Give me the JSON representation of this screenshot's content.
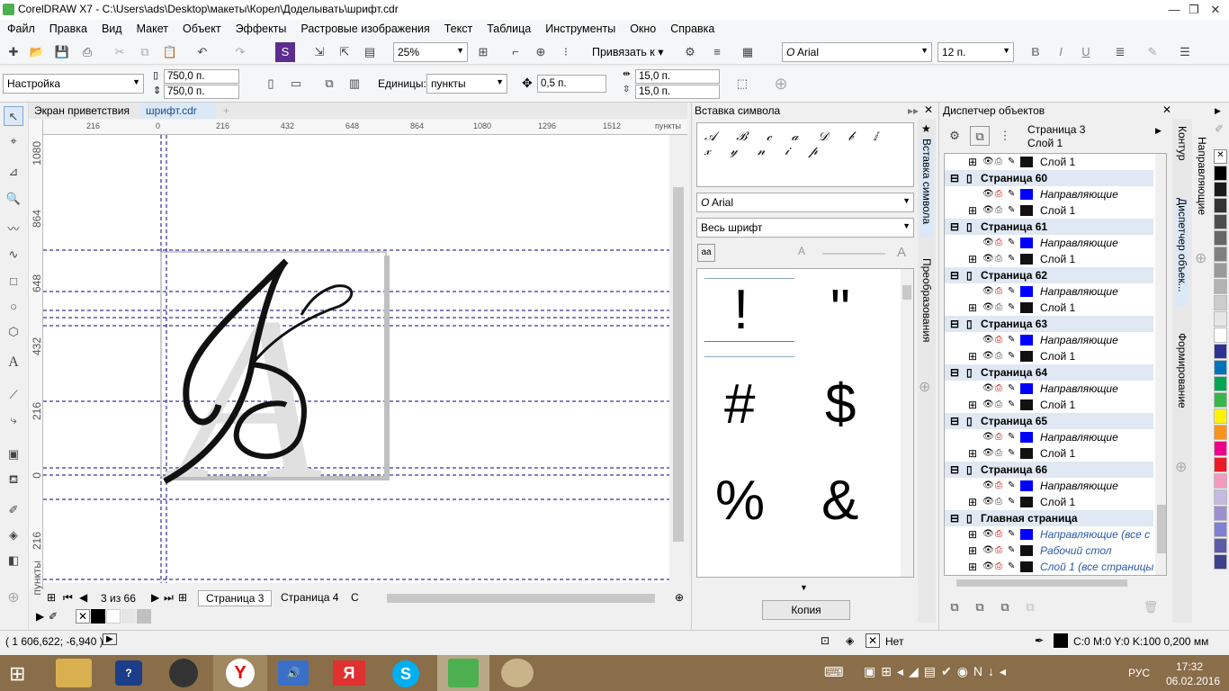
{
  "window": {
    "title": "CorelDRAW X7 - C:\\Users\\ads\\Desktop\\макеты\\Корел\\Доделывать\\шрифт.cdr",
    "min": "—",
    "max": "❐",
    "close": "✕"
  },
  "menu": [
    "Файл",
    "Правка",
    "Вид",
    "Макет",
    "Объект",
    "Эффекты",
    "Растровые изображения",
    "Текст",
    "Таблица",
    "Инструменты",
    "Окно",
    "Справка"
  ],
  "toolbar": {
    "zoom": "25%",
    "snap": "Привязать к",
    "font": "Arial",
    "size": "12 п."
  },
  "propbar": {
    "preset": "Настройка",
    "width": "750,0 п.",
    "height": "750,0 п.",
    "units_label": "Единицы:",
    "units": "пункты",
    "nudge": "0,5 п.",
    "dup_x": "15,0 п.",
    "dup_y": "15,0 п."
  },
  "doc_tabs": {
    "welcome": "Экран приветствия",
    "file": "шрифт.cdr"
  },
  "ruler_h": [
    "216",
    "0",
    "216",
    "432",
    "648",
    "864",
    "1080",
    "1296",
    "1512",
    "пункты"
  ],
  "ruler_v": [
    "1080",
    "864",
    "648",
    "432",
    "216",
    "0",
    "216",
    "пункты"
  ],
  "page_nav": {
    "counter": "3 из 66",
    "p3": "Страница 3",
    "p4": "Страница 4",
    "more": "С"
  },
  "symbol_panel": {
    "title": "Вставка символа",
    "font": "Arial",
    "subset": "Весь шрифт",
    "glyphs": [
      "!",
      "\"",
      "#",
      "$",
      "%",
      "&"
    ],
    "copy_button": "Копия",
    "vtab1": "Вставка символа",
    "vtab2": "Преобразования"
  },
  "object_panel": {
    "title": "Диспетчер объектов",
    "page": "Страница 3",
    "layer": "Слой 1",
    "rows": [
      {
        "t": "layer",
        "name": "Слой 1",
        "color": "#111"
      },
      {
        "t": "page",
        "name": "Страница 60"
      },
      {
        "t": "guide",
        "name": "Направляющие",
        "color": "#0000ff"
      },
      {
        "t": "layer",
        "name": "Слой 1",
        "color": "#111"
      },
      {
        "t": "page",
        "name": "Страница 61"
      },
      {
        "t": "guide",
        "name": "Направляющие",
        "color": "#0000ff"
      },
      {
        "t": "layer",
        "name": "Слой 1",
        "color": "#111"
      },
      {
        "t": "page",
        "name": "Страница 62"
      },
      {
        "t": "guide",
        "name": "Направляющие",
        "color": "#0000ff"
      },
      {
        "t": "layer",
        "name": "Слой 1",
        "color": "#111"
      },
      {
        "t": "page",
        "name": "Страница 63"
      },
      {
        "t": "guide",
        "name": "Направляющие",
        "color": "#0000ff"
      },
      {
        "t": "layer",
        "name": "Слой 1",
        "color": "#111"
      },
      {
        "t": "page",
        "name": "Страница 64"
      },
      {
        "t": "guide",
        "name": "Направляющие",
        "color": "#0000ff"
      },
      {
        "t": "layer",
        "name": "Слой 1",
        "color": "#111"
      },
      {
        "t": "page",
        "name": "Страница 65"
      },
      {
        "t": "guide",
        "name": "Направляющие",
        "color": "#0000ff"
      },
      {
        "t": "layer",
        "name": "Слой 1",
        "color": "#111"
      },
      {
        "t": "page",
        "name": "Страница 66"
      },
      {
        "t": "guide",
        "name": "Направляющие",
        "color": "#0000ff"
      },
      {
        "t": "layer",
        "name": "Слой 1",
        "color": "#111"
      },
      {
        "t": "page",
        "name": "Главная страница"
      },
      {
        "t": "master",
        "name": "Направляющие (все с",
        "color": "#0000ff"
      },
      {
        "t": "master",
        "name": "Рабочий стол",
        "color": "#111"
      },
      {
        "t": "master",
        "name": "Слой 1 (все страницы",
        "color": "#111"
      }
    ],
    "vtab_contour": "Контур",
    "vtab_manager": "Диспетчер объек...",
    "vtab_shaping": "Формирование",
    "vtab_guides": "Направляющие"
  },
  "status": {
    "coords": "( 1 606,622; -6,940 )",
    "fill": "Нет",
    "outline": "C:0 M:0 Y:0 K:100  0,200 мм"
  },
  "taskbar": {
    "lang": "РУС",
    "time": "17:32",
    "date": "06.02.2016"
  },
  "palette_right": [
    "#000000",
    "#1a1a1a",
    "#333333",
    "#4d4d4d",
    "#666666",
    "#808080",
    "#999999",
    "#b3b3b3",
    "#cccccc",
    "#e6e6e6",
    "#ffffff",
    "#2e3192",
    "#0072bc",
    "#00a651",
    "#39b54a",
    "#fff200",
    "#f7941d",
    "#ec008c",
    "#ed1c24",
    "#f49ac1",
    "#c6b9e0",
    "#9b8fd0",
    "#7f7fd5",
    "#5c5ca8",
    "#3f3f8f"
  ]
}
